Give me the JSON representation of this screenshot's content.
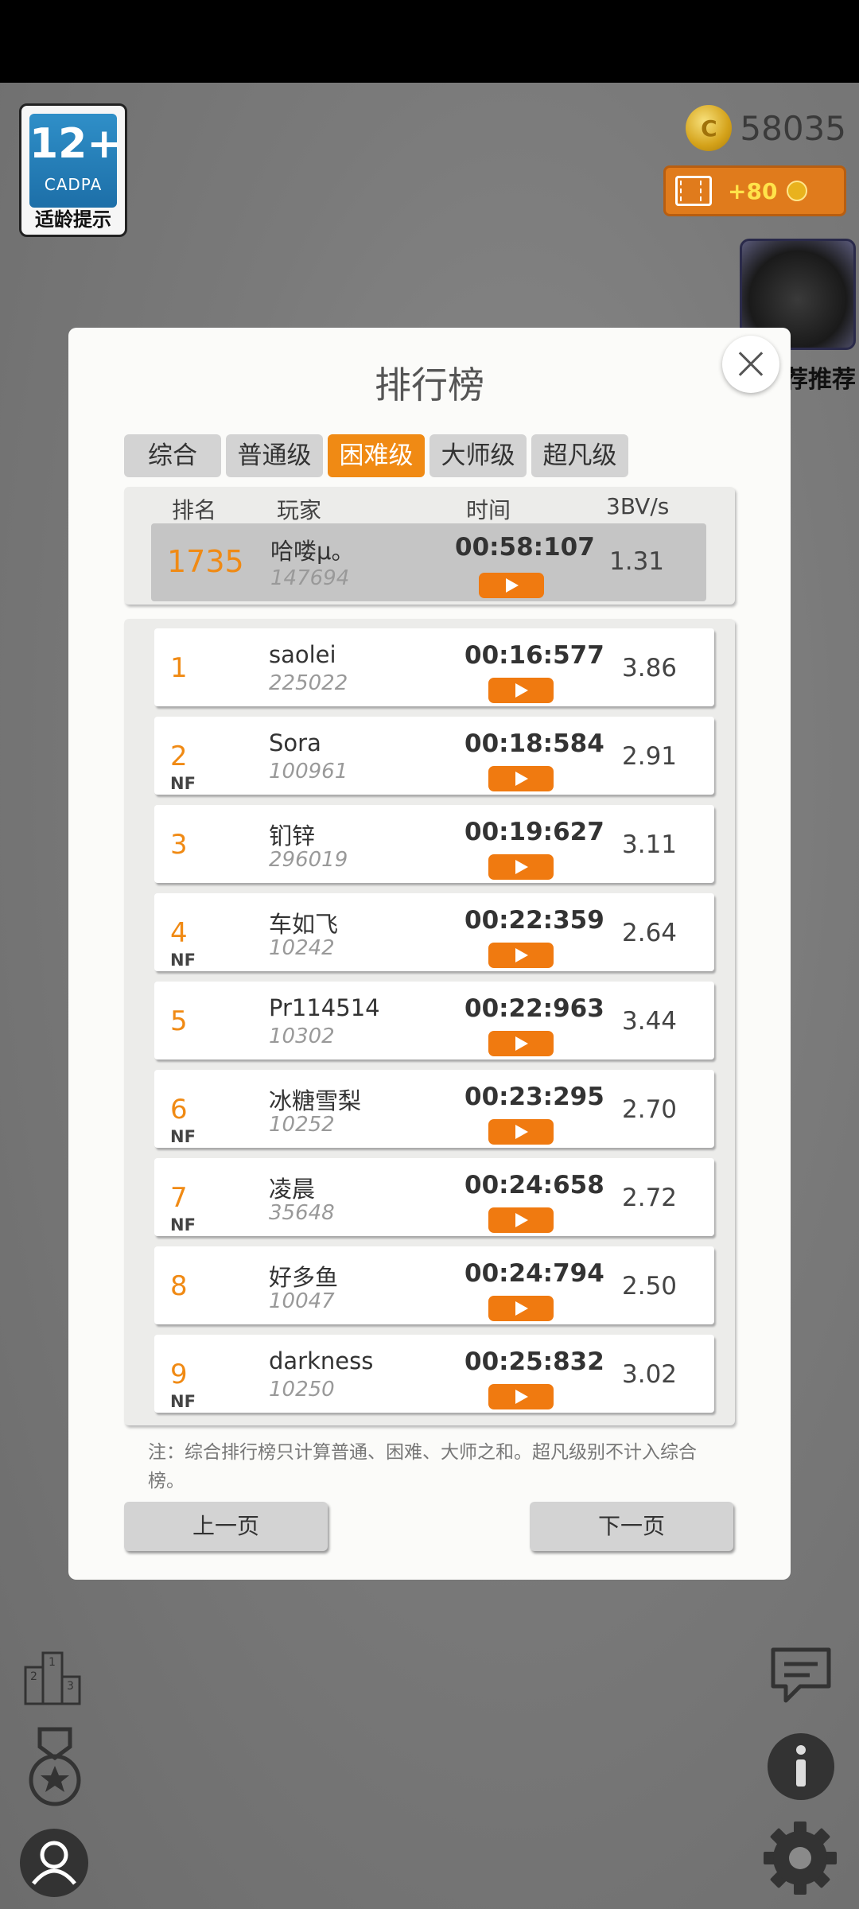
{
  "age_badge": {
    "number": "12+",
    "org": "CADPA",
    "label": "适龄提示"
  },
  "coins": {
    "count": "58035"
  },
  "video_reward": {
    "label": "+80"
  },
  "recommend": {
    "label": "精品推荐",
    "visible_label": "荐推荐"
  },
  "dialog": {
    "title": "排行榜",
    "tabs": [
      {
        "label": "综合",
        "active": false
      },
      {
        "label": "普通级",
        "active": false
      },
      {
        "label": "困难级",
        "active": true
      },
      {
        "label": "大师级",
        "active": false
      },
      {
        "label": "超凡级",
        "active": false
      }
    ],
    "headers": {
      "rank": "排名",
      "player": "玩家",
      "time": "时间",
      "rate": "3BV/s"
    },
    "me": {
      "rank": "1735",
      "name": "哈喽μ。",
      "score": "147694",
      "time": "00:58:107",
      "rate": "1.31"
    },
    "entries": [
      {
        "rank": "1",
        "nf": "",
        "name": "saolei",
        "score": "225022",
        "time": "00:16:577",
        "rate": "3.86"
      },
      {
        "rank": "2",
        "nf": "NF",
        "name": "Sora",
        "score": "100961",
        "time": "00:18:584",
        "rate": "2.91"
      },
      {
        "rank": "3",
        "nf": "",
        "name": "钔锌",
        "score": "296019",
        "time": "00:19:627",
        "rate": "3.11"
      },
      {
        "rank": "4",
        "nf": "NF",
        "name": "车如飞",
        "score": "10242",
        "time": "00:22:359",
        "rate": "2.64"
      },
      {
        "rank": "5",
        "nf": "",
        "name": "Pr114514",
        "score": "10302",
        "time": "00:22:963",
        "rate": "3.44"
      },
      {
        "rank": "6",
        "nf": "NF",
        "name": "冰糖雪梨",
        "score": "10252",
        "time": "00:23:295",
        "rate": "2.70"
      },
      {
        "rank": "7",
        "nf": "NF",
        "name": "凌晨",
        "score": "35648",
        "time": "00:24:658",
        "rate": "2.72"
      },
      {
        "rank": "8",
        "nf": "",
        "name": "好多鱼",
        "score": "10047",
        "time": "00:24:794",
        "rate": "2.50"
      },
      {
        "rank": "9",
        "nf": "NF",
        "name": "darkness",
        "score": "10250",
        "time": "00:25:832",
        "rate": "3.02"
      }
    ],
    "note": "注：综合排行榜只计算普通、困难、大师之和。超凡级别不计入综合榜。",
    "prev_label": "上一页",
    "next_label": "下一页"
  },
  "colors": {
    "accent": "#f08a14",
    "play": "#f07a10"
  },
  "icons": [
    "podium-icon",
    "medal-icon",
    "profile-icon",
    "chat-icon",
    "info-icon",
    "gear-icon",
    "close-icon",
    "play-icon",
    "video-icon",
    "coin-icon"
  ]
}
